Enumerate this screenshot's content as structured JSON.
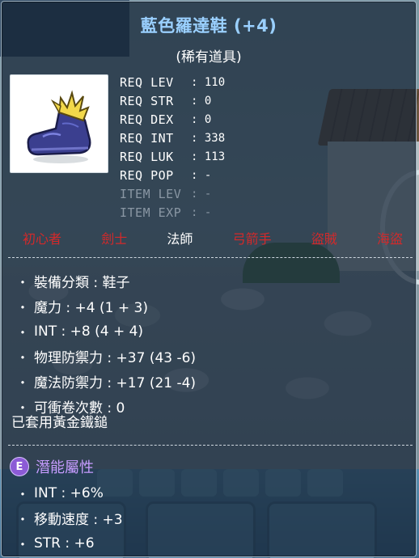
{
  "item": {
    "name": "藍色羅達鞋 (+4)",
    "rarity": "(稀有道具)",
    "icon": "blue-boots-icon"
  },
  "requirements": [
    {
      "label": "REQ LEV",
      "value": "110",
      "dim": false
    },
    {
      "label": "REQ STR",
      "value": "0",
      "dim": false
    },
    {
      "label": "REQ DEX",
      "value": "0",
      "dim": false
    },
    {
      "label": "REQ INT",
      "value": "338",
      "dim": false
    },
    {
      "label": "REQ LUK",
      "value": "113",
      "dim": false
    },
    {
      "label": "REQ POP",
      "value": "-",
      "dim": false
    },
    {
      "label": "ITEM LEV",
      "value": "-",
      "dim": true
    },
    {
      "label": "ITEM EXP",
      "value": "-",
      "dim": true
    }
  ],
  "classes": [
    {
      "name": "初心者",
      "active": false
    },
    {
      "name": "劍士",
      "active": false
    },
    {
      "name": "法師",
      "active": true
    },
    {
      "name": "弓箭手",
      "active": false
    },
    {
      "name": "盜賊",
      "active": false
    },
    {
      "name": "海盜",
      "active": false
    }
  ],
  "stats": [
    "裝備分類 : 鞋子",
    "魔力 : +4 (1 + 3)",
    "INT : +8 (4 + 4)",
    "物理防禦力 : +37 (43 -6)",
    "魔法防禦力 : +17 (21 -4)",
    "可衝卷次數 : 0"
  ],
  "applied_scroll": "已套用黃金鐵鎚",
  "potential": {
    "badge": "E",
    "title": "潛能屬性",
    "lines": [
      "INT : +6%",
      "移動速度 : +3",
      "STR : +6"
    ]
  },
  "colors": {
    "title": "#9ad0ff",
    "restricted_class": "#d4292a",
    "potential": "#c69cff"
  }
}
